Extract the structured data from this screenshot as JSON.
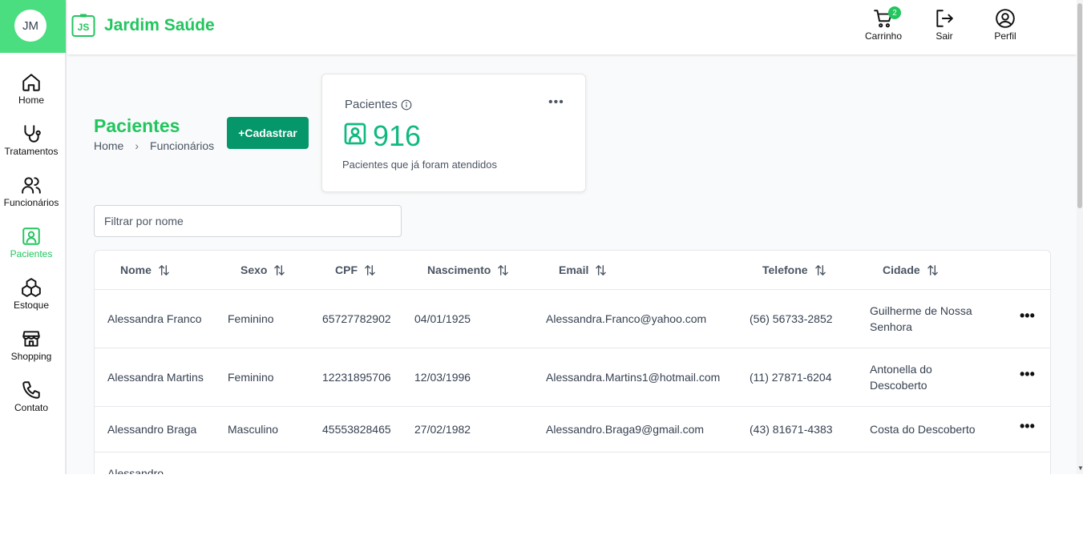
{
  "sidebar": {
    "avatar": "JM",
    "items": [
      {
        "label": "Home"
      },
      {
        "label": "Tratamentos"
      },
      {
        "label": "Funcionários"
      },
      {
        "label": "Pacientes"
      },
      {
        "label": "Estoque"
      },
      {
        "label": "Shopping"
      },
      {
        "label": "Contato"
      }
    ],
    "active_color": "#22c55e"
  },
  "header": {
    "logo_text": "JS",
    "brand": "Jardim Saúde",
    "cart_label": "Carrinho",
    "cart_count": "2",
    "logout_label": "Sair",
    "profile_label": "Perfil"
  },
  "page": {
    "title": "Pacientes",
    "breadcrumb": [
      "Home",
      "Funcionários"
    ],
    "cadastrar_label": "+Cadastrar"
  },
  "stat_card": {
    "title": "Pacientes",
    "value": "916",
    "description": "Pacientes que já foram atendidos"
  },
  "filter": {
    "placeholder": "Filtrar por nome"
  },
  "table": {
    "columns": [
      "Nome",
      "Sexo",
      "CPF",
      "Nascimento",
      "Email",
      "Telefone",
      "Cidade"
    ],
    "rows": [
      {
        "nome": "Alessandra Franco",
        "sexo": "Feminino",
        "cpf": "65727782902",
        "nascimento": "04/01/1925",
        "email": "Alessandra.Franco@yahoo.com",
        "telefone": "(56) 56733-2852",
        "cidade_1": "Guilherme de Nossa",
        "cidade_2": "Senhora"
      },
      {
        "nome": "Alessandra Martins",
        "sexo": "Feminino",
        "cpf": "12231895706",
        "nascimento": "12/03/1996",
        "email": "Alessandra.Martins1@hotmail.com",
        "telefone": "(11) 27871-6204",
        "cidade_1": "Antonella do",
        "cidade_2": "Descoberto"
      },
      {
        "nome": "Alessandro Braga",
        "sexo": "Masculino",
        "cpf": "45553828465",
        "nascimento": "27/02/1982",
        "email": "Alessandro.Braga9@gmail.com",
        "telefone": "(43) 81671-4383",
        "cidade_1": "Costa do Descoberto",
        "cidade_2": ""
      },
      {
        "nome": "Alessandro",
        "sexo": "",
        "cpf": "",
        "nascimento": "",
        "email": "",
        "telefone": "",
        "cidade_1": "",
        "cidade_2": ""
      }
    ]
  },
  "colors": {
    "brand_green": "#22c55e",
    "button_green": "#059669",
    "stat_green": "#10b981"
  }
}
